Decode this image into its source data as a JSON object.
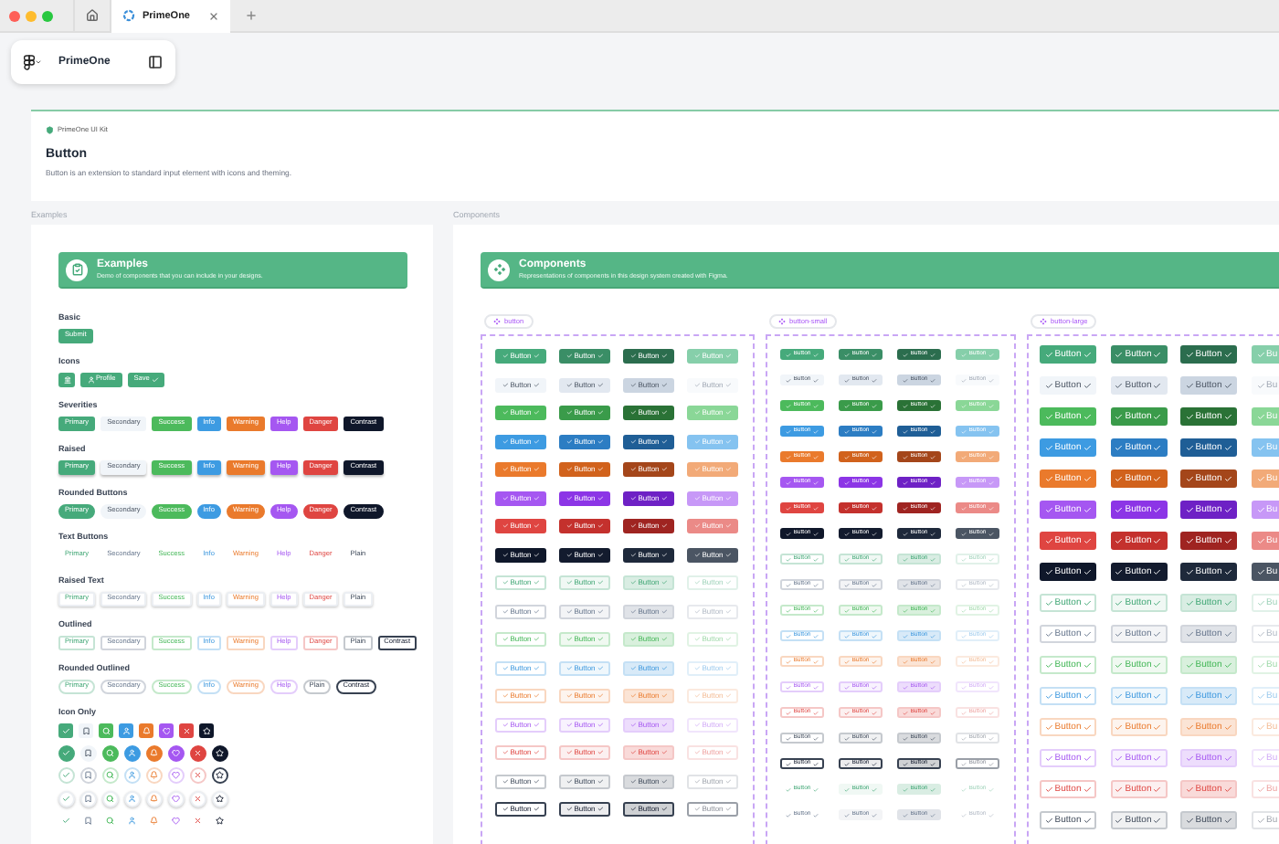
{
  "browser": {
    "tabs": [
      {
        "kind": "home",
        "selected": false
      },
      {
        "kind": "page",
        "title": "PrimeOne",
        "selected": true
      }
    ]
  },
  "toolbar": {
    "file_name": "PrimeOne"
  },
  "header": {
    "kit": "PrimeOne UI Kit",
    "title": "Button",
    "description": "Button is an extension to standard input element with icons and theming."
  },
  "examples": {
    "label": "Examples",
    "banner": {
      "title": "Examples",
      "subtitle": "Demo of components that you can include in your designs."
    },
    "sections": [
      {
        "title": "Basic",
        "rows": [
          {
            "kind": "solid",
            "buttons": [
              {
                "label": "Submit",
                "kind": "primary"
              }
            ]
          }
        ]
      },
      {
        "title": "Icons",
        "rows": [
          {
            "kind": "with_icons",
            "buttons": [
              {
                "kind": "primary"
              },
              {
                "label": "Profile",
                "kind": "primary"
              },
              {
                "label": "Save",
                "kind": "primary"
              }
            ]
          }
        ]
      },
      {
        "title": "Severities",
        "rows": [
          {
            "kind": "solid",
            "buttons": [
              {
                "label": "Primary",
                "kind": "primary"
              },
              {
                "label": "Secondary",
                "kind": "secondary"
              },
              {
                "label": "Success",
                "kind": "success"
              },
              {
                "label": "Info",
                "kind": "info"
              },
              {
                "label": "Warning",
                "kind": "warning"
              },
              {
                "label": "Help",
                "kind": "help"
              },
              {
                "label": "Danger",
                "kind": "danger"
              },
              {
                "label": "Contrast",
                "kind": "contrast"
              }
            ]
          }
        ]
      },
      {
        "title": "Raised",
        "rows": [
          {
            "kind": "raised",
            "buttons": [
              {
                "label": "Primary",
                "kind": "primary"
              },
              {
                "label": "Secondary",
                "kind": "secondary"
              },
              {
                "label": "Success",
                "kind": "success"
              },
              {
                "label": "Info",
                "kind": "info"
              },
              {
                "label": "Warning",
                "kind": "warning"
              },
              {
                "label": "Help",
                "kind": "help"
              },
              {
                "label": "Danger",
                "kind": "danger"
              },
              {
                "label": "Contrast",
                "kind": "contrast"
              }
            ]
          }
        ]
      },
      {
        "title": "Rounded Buttons",
        "rows": [
          {
            "kind": "rounded",
            "buttons": [
              {
                "label": "Primary",
                "kind": "primary"
              },
              {
                "label": "Secondary",
                "kind": "secondary"
              },
              {
                "label": "Success",
                "kind": "success"
              },
              {
                "label": "Info",
                "kind": "info"
              },
              {
                "label": "Warning",
                "kind": "warning"
              },
              {
                "label": "Help",
                "kind": "help"
              },
              {
                "label": "Danger",
                "kind": "danger"
              },
              {
                "label": "Contrast",
                "kind": "contrast"
              }
            ]
          }
        ]
      },
      {
        "title": "Text Buttons",
        "rows": [
          {
            "kind": "text",
            "buttons": [
              {
                "label": "Primary",
                "kind": "primary"
              },
              {
                "label": "Secondary",
                "kind": "secondary"
              },
              {
                "label": "Success",
                "kind": "success"
              },
              {
                "label": "Info",
                "kind": "info"
              },
              {
                "label": "Warning",
                "kind": "warning"
              },
              {
                "label": "Help",
                "kind": "help"
              },
              {
                "label": "Danger",
                "kind": "danger"
              },
              {
                "label": "Plain",
                "kind": "plain"
              }
            ]
          }
        ]
      },
      {
        "title": "Raised Text",
        "rows": [
          {
            "kind": "raised_text",
            "buttons": [
              {
                "label": "Primary",
                "kind": "primary"
              },
              {
                "label": "Secondary",
                "kind": "secondary"
              },
              {
                "label": "Success",
                "kind": "success"
              },
              {
                "label": "Info",
                "kind": "info"
              },
              {
                "label": "Warning",
                "kind": "warning"
              },
              {
                "label": "Help",
                "kind": "help"
              },
              {
                "label": "Danger",
                "kind": "danger"
              },
              {
                "label": "Plain",
                "kind": "plain"
              }
            ]
          }
        ]
      },
      {
        "title": "Outlined",
        "rows": [
          {
            "kind": "outlined",
            "buttons": [
              {
                "label": "Primary",
                "kind": "primary"
              },
              {
                "label": "Secondary",
                "kind": "secondary"
              },
              {
                "label": "Success",
                "kind": "success"
              },
              {
                "label": "Info",
                "kind": "info"
              },
              {
                "label": "Warning",
                "kind": "warning"
              },
              {
                "label": "Help",
                "kind": "help"
              },
              {
                "label": "Danger",
                "kind": "danger"
              },
              {
                "label": "Plain",
                "kind": "plain"
              },
              {
                "label": "Contrast",
                "kind": "contrast"
              }
            ]
          }
        ]
      },
      {
        "title": "Rounded Outlined",
        "rows": [
          {
            "kind": "rounded_outlined",
            "buttons": [
              {
                "label": "Primary",
                "kind": "primary"
              },
              {
                "label": "Secondary",
                "kind": "secondary"
              },
              {
                "label": "Success",
                "kind": "success"
              },
              {
                "label": "Info",
                "kind": "info"
              },
              {
                "label": "Warning",
                "kind": "warning"
              },
              {
                "label": "Help",
                "kind": "help"
              },
              {
                "label": "Plain",
                "kind": "plain"
              },
              {
                "label": "Contrast",
                "kind": "contrast"
              }
            ]
          }
        ]
      },
      {
        "title": "Icon Only",
        "rows": [
          {
            "kind": "icon_square",
            "buttons": [
              {
                "kind": "primary"
              },
              {
                "kind": "secondary"
              },
              {
                "kind": "success"
              },
              {
                "kind": "info"
              },
              {
                "kind": "warning"
              },
              {
                "kind": "help"
              },
              {
                "kind": "danger"
              },
              {
                "kind": "contrast"
              }
            ]
          },
          {
            "kind": "icon_round",
            "buttons": [
              {
                "kind": "primary"
              },
              {
                "kind": "secondary"
              },
              {
                "kind": "success"
              },
              {
                "kind": "info"
              },
              {
                "kind": "warning"
              },
              {
                "kind": "help"
              },
              {
                "kind": "danger"
              },
              {
                "kind": "contrast"
              }
            ]
          },
          {
            "kind": "icon_outlined",
            "buttons": [
              {
                "kind": "primary"
              },
              {
                "kind": "secondary"
              },
              {
                "kind": "success"
              },
              {
                "kind": "info"
              },
              {
                "kind": "warning"
              },
              {
                "kind": "help"
              },
              {
                "kind": "danger"
              },
              {
                "kind": "contrast"
              }
            ]
          },
          {
            "kind": "icon_raised_text",
            "buttons": [
              {
                "kind": "primary"
              },
              {
                "kind": "secondary"
              },
              {
                "kind": "success"
              },
              {
                "kind": "info"
              },
              {
                "kind": "warning"
              },
              {
                "kind": "help"
              },
              {
                "kind": "danger"
              },
              {
                "kind": "contrast"
              }
            ]
          },
          {
            "kind": "icon_text",
            "buttons": [
              {
                "kind": "primary"
              },
              {
                "kind": "secondary"
              },
              {
                "kind": "success"
              },
              {
                "kind": "info"
              },
              {
                "kind": "warning"
              },
              {
                "kind": "help"
              },
              {
                "kind": "danger"
              },
              {
                "kind": "contrast"
              }
            ]
          }
        ]
      }
    ]
  },
  "components": {
    "label": "Components",
    "banner": {
      "title": "Components",
      "subtitle": "Representations of components in this design system created with Figma."
    },
    "panels": [
      {
        "tag": "button",
        "kind": "normal",
        "columns": [
          {
            "kind": "default"
          },
          {
            "kind": "hover"
          },
          {
            "kind": "pressed"
          },
          {
            "kind": "disabled"
          }
        ],
        "groups": [
          {
            "kind": "solid",
            "rows": [
              {
                "kind": "primary",
                "labels": [
                  "Button",
                  "Button",
                  "Button",
                  "Button"
                ]
              },
              {
                "kind": "secondary",
                "labels": [
                  "Button",
                  "Button",
                  "Button",
                  "Button"
                ]
              },
              {
                "kind": "success",
                "labels": [
                  "Button",
                  "Button",
                  "Button",
                  "Button"
                ]
              },
              {
                "kind": "info",
                "labels": [
                  "Button",
                  "Button",
                  "Button",
                  "Button"
                ]
              },
              {
                "kind": "warning",
                "labels": [
                  "Button",
                  "Button",
                  "Button",
                  "Button"
                ]
              },
              {
                "kind": "help",
                "labels": [
                  "Button",
                  "Button",
                  "Button",
                  "Button"
                ]
              },
              {
                "kind": "danger",
                "labels": [
                  "Button",
                  "Button",
                  "Button",
                  "Button"
                ]
              },
              {
                "kind": "contrast",
                "labels": [
                  "Button",
                  "Button",
                  "Button",
                  "Button"
                ]
              }
            ]
          },
          {
            "kind": "outlined",
            "rows": [
              {
                "kind": "primary",
                "labels": [
                  "Button",
                  "Button",
                  "Button",
                  "Button"
                ]
              },
              {
                "kind": "secondary",
                "labels": [
                  "Button",
                  "Button",
                  "Button",
                  "Button"
                ]
              },
              {
                "kind": "success",
                "labels": [
                  "Button",
                  "Button",
                  "Button",
                  "Button"
                ]
              },
              {
                "kind": "info",
                "labels": [
                  "Button",
                  "Button",
                  "Button",
                  "Button"
                ]
              },
              {
                "kind": "warning",
                "labels": [
                  "Button",
                  "Button",
                  "Button",
                  "Button"
                ]
              },
              {
                "kind": "help",
                "labels": [
                  "Button",
                  "Button",
                  "Button",
                  "Button"
                ]
              },
              {
                "kind": "danger",
                "labels": [
                  "Button",
                  "Button",
                  "Button",
                  "Button"
                ]
              },
              {
                "kind": "plain",
                "labels": [
                  "Button",
                  "Button",
                  "Button",
                  "Button"
                ]
              },
              {
                "kind": "contrast",
                "labels": [
                  "Button",
                  "Button",
                  "Button",
                  "Button"
                ]
              }
            ]
          }
        ]
      },
      {
        "tag": "button-small",
        "kind": "small",
        "columns": [
          {
            "kind": "default"
          },
          {
            "kind": "hover"
          },
          {
            "kind": "pressed"
          },
          {
            "kind": "disabled"
          }
        ],
        "groups": [
          {
            "kind": "solid",
            "rows": [
              {
                "kind": "primary",
                "labels": [
                  "Button",
                  "Button",
                  "Button",
                  "Button"
                ]
              },
              {
                "kind": "secondary",
                "labels": [
                  "Button",
                  "Button",
                  "Button",
                  "Button"
                ]
              },
              {
                "kind": "success",
                "labels": [
                  "Button",
                  "Button",
                  "Button",
                  "Button"
                ]
              },
              {
                "kind": "info",
                "labels": [
                  "Button",
                  "Button",
                  "Button",
                  "Button"
                ]
              },
              {
                "kind": "warning",
                "labels": [
                  "Button",
                  "Button",
                  "Button",
                  "Button"
                ]
              },
              {
                "kind": "help",
                "labels": [
                  "Button",
                  "Button",
                  "Button",
                  "Button"
                ]
              },
              {
                "kind": "danger",
                "labels": [
                  "Button",
                  "Button",
                  "Button",
                  "Button"
                ]
              },
              {
                "kind": "contrast",
                "labels": [
                  "Button",
                  "Button",
                  "Button",
                  "Button"
                ]
              }
            ]
          },
          {
            "kind": "outlined",
            "rows": [
              {
                "kind": "primary",
                "labels": [
                  "Button",
                  "Button",
                  "Button",
                  "Button"
                ]
              },
              {
                "kind": "secondary",
                "labels": [
                  "Button",
                  "Button",
                  "Button",
                  "Button"
                ]
              },
              {
                "kind": "success",
                "labels": [
                  "Button",
                  "Button",
                  "Button",
                  "Button"
                ]
              },
              {
                "kind": "info",
                "labels": [
                  "Button",
                  "Button",
                  "Button",
                  "Button"
                ]
              },
              {
                "kind": "warning",
                "labels": [
                  "Button",
                  "Button",
                  "Button",
                  "Button"
                ]
              },
              {
                "kind": "help",
                "labels": [
                  "Button",
                  "Button",
                  "Button",
                  "Button"
                ]
              },
              {
                "kind": "danger",
                "labels": [
                  "Button",
                  "Button",
                  "Button",
                  "Button"
                ]
              },
              {
                "kind": "plain",
                "labels": [
                  "Button",
                  "Button",
                  "Button",
                  "Button"
                ]
              },
              {
                "kind": "contrast",
                "labels": [
                  "Button",
                  "Button",
                  "Button",
                  "Button"
                ]
              }
            ]
          },
          {
            "kind": "text",
            "rows": [
              {
                "kind": "primary",
                "labels": [
                  "Button",
                  "Button",
                  "Button",
                  "Button"
                ]
              },
              {
                "kind": "secondary",
                "labels": [
                  "Button",
                  "Button",
                  "Button",
                  "Button"
                ]
              }
            ]
          }
        ]
      },
      {
        "tag": "button-large",
        "kind": "large",
        "columns": [
          {
            "kind": "default"
          },
          {
            "kind": "hover"
          },
          {
            "kind": "pressed"
          },
          {
            "kind": "disabled"
          }
        ],
        "groups": [
          {
            "kind": "solid",
            "rows": [
              {
                "kind": "primary",
                "labels": [
                  "Button",
                  "Button",
                  "Button",
                  "Bu"
                ]
              },
              {
                "kind": "secondary",
                "labels": [
                  "Button",
                  "Button",
                  "Button",
                  "Bu"
                ]
              },
              {
                "kind": "success",
                "labels": [
                  "Button",
                  "Button",
                  "Button",
                  "Bu"
                ]
              },
              {
                "kind": "info",
                "labels": [
                  "Button",
                  "Button",
                  "Button",
                  "Bu"
                ]
              },
              {
                "kind": "warning",
                "labels": [
                  "Button",
                  "Button",
                  "Button",
                  "Bu"
                ]
              },
              {
                "kind": "help",
                "labels": [
                  "Button",
                  "Button",
                  "Button",
                  "Bu"
                ]
              },
              {
                "kind": "danger",
                "labels": [
                  "Button",
                  "Button",
                  "Button",
                  "Bu"
                ]
              },
              {
                "kind": "contrast",
                "labels": [
                  "Button",
                  "Button",
                  "Button",
                  "Bu"
                ]
              }
            ]
          },
          {
            "kind": "outlined",
            "rows": [
              {
                "kind": "primary",
                "labels": [
                  "Button",
                  "Button",
                  "Button",
                  "Bu"
                ]
              },
              {
                "kind": "secondary",
                "labels": [
                  "Button",
                  "Button",
                  "Button",
                  "Bu"
                ]
              },
              {
                "kind": "success",
                "labels": [
                  "Button",
                  "Button",
                  "Button",
                  "Bu"
                ]
              },
              {
                "kind": "info",
                "labels": [
                  "Button",
                  "Button",
                  "Button",
                  "Bu"
                ]
              },
              {
                "kind": "warning",
                "labels": [
                  "Button",
                  "Button",
                  "Button",
                  "Bu"
                ]
              },
              {
                "kind": "help",
                "labels": [
                  "Button",
                  "Button",
                  "Button",
                  "Bu"
                ]
              },
              {
                "kind": "danger",
                "labels": [
                  "Button",
                  "Button",
                  "Button",
                  "Bu"
                ]
              },
              {
                "kind": "plain",
                "labels": [
                  "Button",
                  "Button",
                  "Button",
                  "Bu"
                ]
              }
            ]
          }
        ]
      }
    ]
  }
}
